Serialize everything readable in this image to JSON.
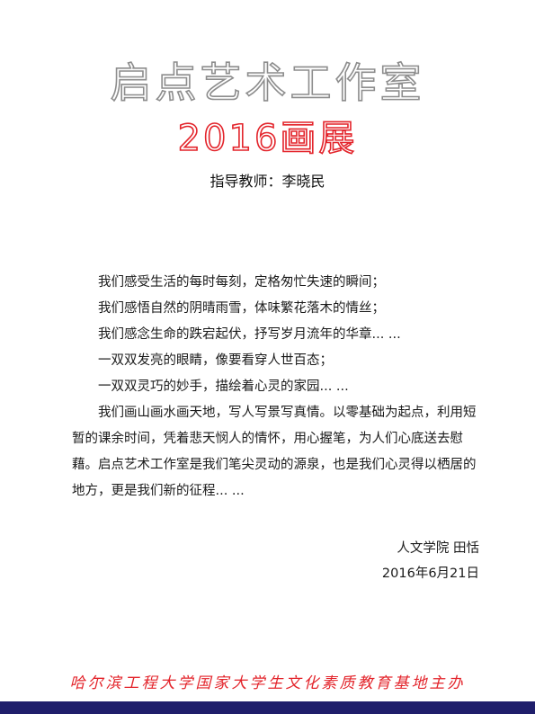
{
  "header": {
    "title": "启点艺术工作室",
    "subtitle": "2016画展",
    "teacher": "指导教师：李晓民"
  },
  "body": {
    "lines": [
      "我们感受生活的每时每刻，定格匆忙失速的瞬间；",
      "我们感悟自然的阴晴雨雪，体味繁花落木的情丝；",
      "我们感念生命的跌宕起伏，抒写岁月流年的华章... ...",
      "一双双发亮的眼睛，像要看穿人世百态；",
      "一双双灵巧的妙手，描绘着心灵的家园... ...",
      "我们画山画水画天地，写人写景写真情。以零基础为起点，利用短暂的课余时间，凭着悲天悯人的情怀，用心握笔，为人们心底送去慰藉。启点艺术工作室是我们笔尖灵动的源泉，也是我们心灵得以栖居的地方，更是我们新的征程... ..."
    ]
  },
  "signature": {
    "author": "人文学院 田恬",
    "date": "2016年6月21日"
  },
  "footer": {
    "sponsor": "哈尔滨工程大学国家大学生文化素质教育基地主办"
  },
  "colors": {
    "accent_red": "#e3242b",
    "title_gray": "#8d8d8d",
    "bar_navy": "#1f1e6b"
  }
}
